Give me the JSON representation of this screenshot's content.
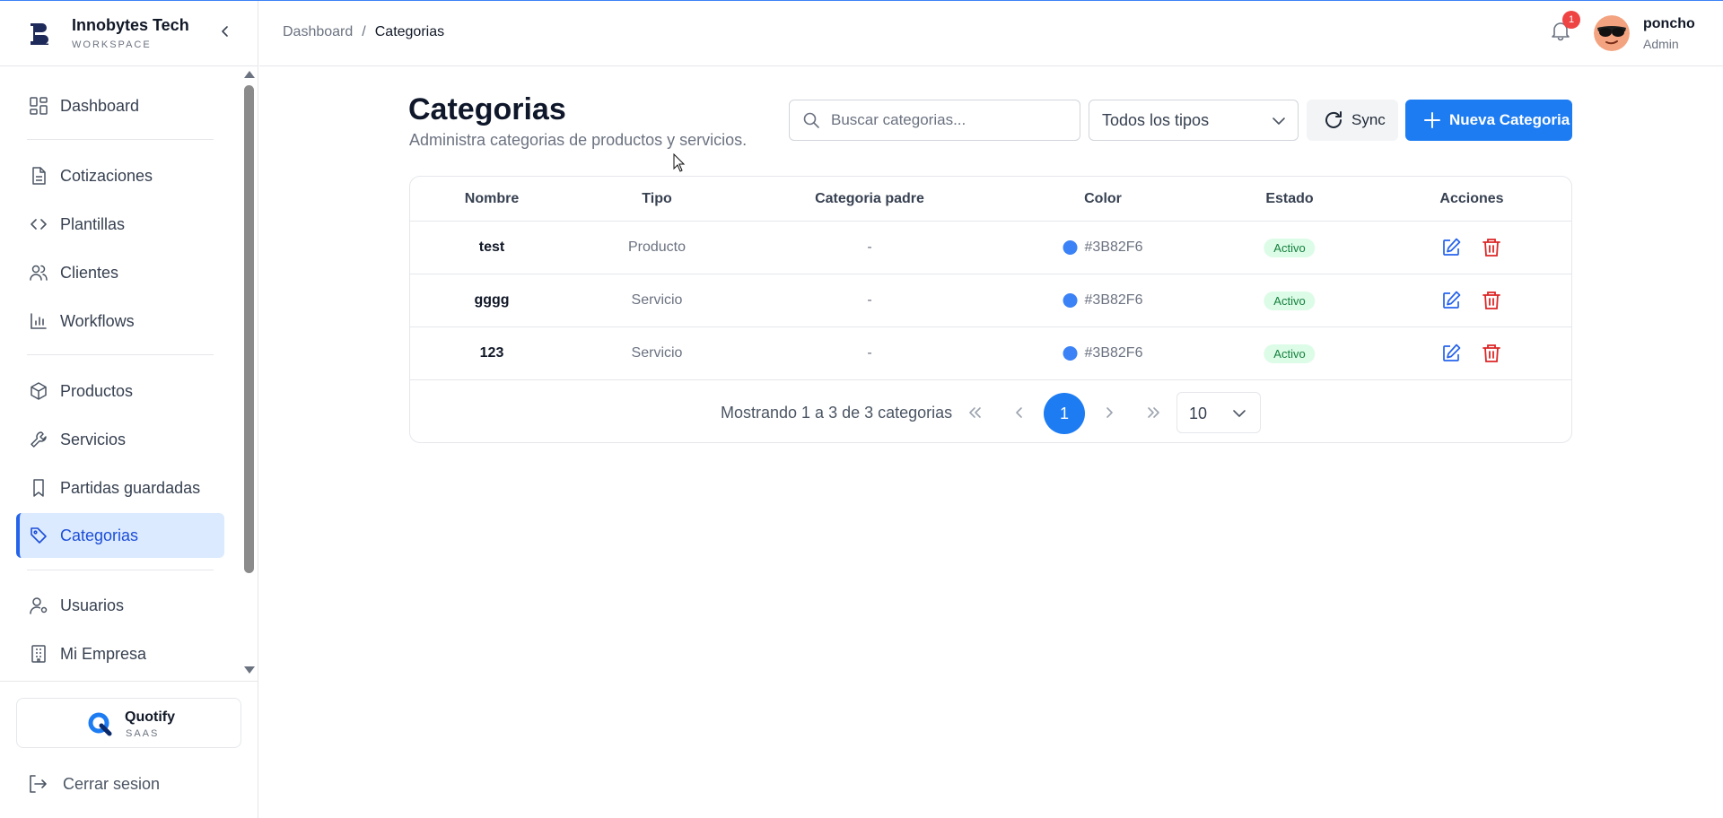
{
  "brand": {
    "name": "Innobytes Tech",
    "subtitle": "WORKSPACE"
  },
  "breadcrumb": {
    "root": "Dashboard",
    "separator": "/",
    "current": "Categorias"
  },
  "user": {
    "name": "poncho",
    "role": "Admin",
    "notifications": "1"
  },
  "sidebar": {
    "items": [
      {
        "label": "Dashboard",
        "icon": "dashboard-icon"
      },
      {
        "label": "Cotizaciones",
        "icon": "document-icon"
      },
      {
        "label": "Plantillas",
        "icon": "code-icon"
      },
      {
        "label": "Clientes",
        "icon": "users-icon"
      },
      {
        "label": "Workflows",
        "icon": "bar-chart-icon"
      },
      {
        "label": "Productos",
        "icon": "box-icon"
      },
      {
        "label": "Servicios",
        "icon": "wrench-icon"
      },
      {
        "label": "Partidas guardadas",
        "icon": "bookmark-icon"
      },
      {
        "label": "Categorias",
        "icon": "tag-icon",
        "active": true
      },
      {
        "label": "Usuarios",
        "icon": "user-cog-icon"
      },
      {
        "label": "Mi Empresa",
        "icon": "building-icon"
      }
    ],
    "app_card": {
      "name": "Quotify",
      "subtitle": "SAAS"
    },
    "logout_label": "Cerrar sesion"
  },
  "page": {
    "title": "Categorias",
    "subtitle": "Administra categorias de productos y servicios."
  },
  "toolbar": {
    "search_placeholder": "Buscar categorias...",
    "search_value": "",
    "type_filter": "Todos los tipos",
    "sync_label": "Sync",
    "new_label": "Nueva Categoria"
  },
  "table": {
    "headers": [
      "Nombre",
      "Tipo",
      "Categoria padre",
      "Color",
      "Estado",
      "Acciones"
    ],
    "rows": [
      {
        "nombre": "test",
        "tipo": "Producto",
        "padre": "-",
        "color": "#3B82F6",
        "estado": "Activo"
      },
      {
        "nombre": "gggg",
        "tipo": "Servicio",
        "padre": "-",
        "color": "#3B82F6",
        "estado": "Activo"
      },
      {
        "nombre": "123",
        "tipo": "Servicio",
        "padre": "-",
        "color": "#3B82F6",
        "estado": "Activo"
      }
    ]
  },
  "pagination": {
    "summary": "Mostrando 1 a 3 de 3 categorias",
    "current_page": "1",
    "per_page": "10"
  },
  "colors": {
    "accent": "#1d7cf2",
    "category_color": "#3B82F6",
    "status_active": "#15803d",
    "delete": "#dc2626"
  }
}
